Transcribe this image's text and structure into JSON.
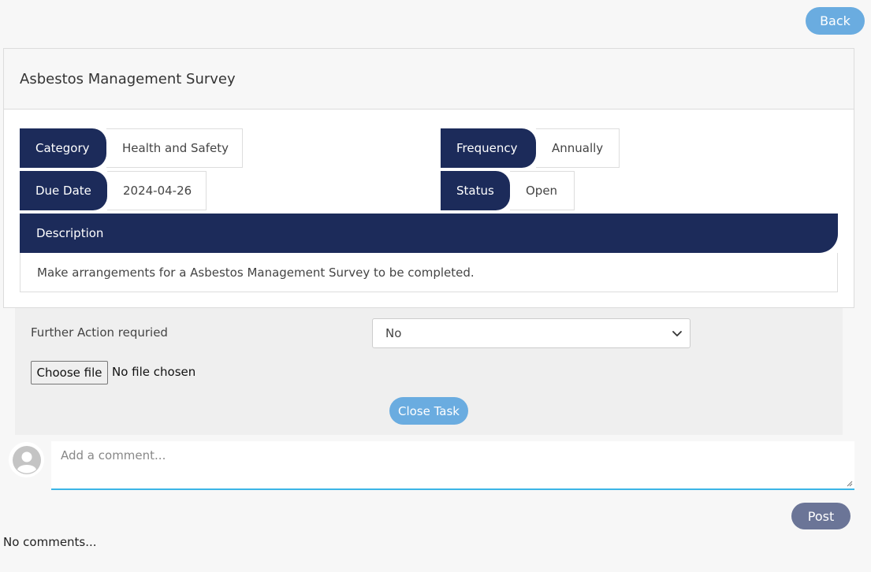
{
  "header": {
    "back_label": "Back"
  },
  "task": {
    "title": "Asbestos Management Survey",
    "fields": {
      "category_label": "Category",
      "category_value": "Health and Safety",
      "frequency_label": "Frequency",
      "frequency_value": "Annually",
      "due_date_label": "Due Date",
      "due_date_value": "2024-04-26",
      "status_label": "Status",
      "status_value": "Open"
    },
    "description_label": "Description",
    "description_text": "Make arrangements for a Asbestos Management Survey to be completed."
  },
  "action": {
    "further_action_label": "Further Action requried",
    "further_action_selected": "No",
    "file_button_label": "Choose file",
    "file_status": "No file chosen",
    "close_task_label": "Close Task"
  },
  "comments": {
    "placeholder": "Add a comment...",
    "post_label": "Post",
    "empty_text": "No comments..."
  },
  "colors": {
    "navy": "#1c2b5a",
    "accent_blue": "#6aace0",
    "post_button": "#6b7597",
    "focus_line": "#3bb5e6"
  },
  "icons": {
    "avatar": "user-avatar-icon",
    "select_chevron": "chevron-down-icon"
  }
}
